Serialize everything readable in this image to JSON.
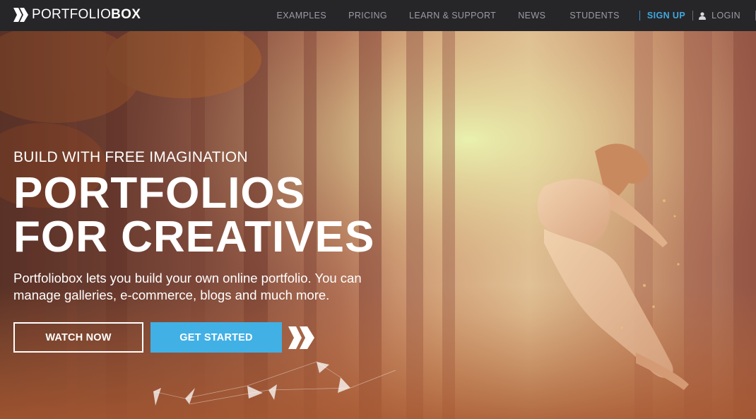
{
  "nav": {
    "brand_light": "PORTFOLIO",
    "brand_bold": "BOX",
    "links": {
      "examples": "EXAMPLES",
      "pricing": "PRICING",
      "learn": "LEARN & SUPPORT",
      "news": "NEWS",
      "students": "STUDENTS",
      "signup": "SIGN UP",
      "login": "LOGIN"
    }
  },
  "hero": {
    "tagline": "BUILD WITH FREE IMAGINATION",
    "headline_line1": "PORTFOLIOS",
    "headline_line2": "FOR CREATIVES",
    "description": "Portfoliobox lets you build your own online portfolio. You can manage galleries, e-commerce, blogs and much more.",
    "watch_button": "WATCH NOW",
    "start_button": "GET STARTED"
  },
  "colors": {
    "nav_bg": "#262629",
    "accent": "#41b0e5",
    "signup": "#41a8de"
  },
  "icons": {
    "brand": "brand-chevron-icon",
    "login": "user-icon",
    "hero_mark": "double-chevron-icon"
  }
}
